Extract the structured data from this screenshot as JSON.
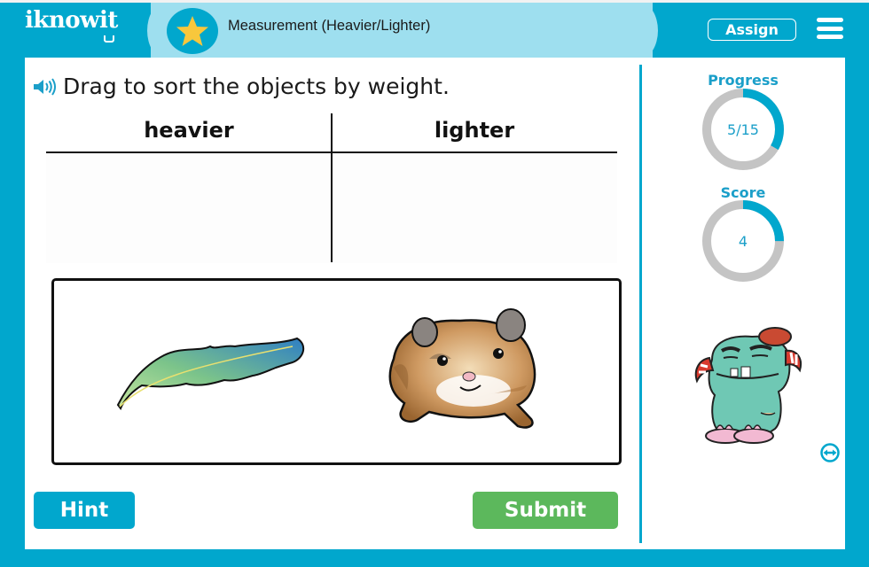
{
  "header": {
    "logo_text": "iknowit",
    "lesson_title": "Measurement (Heavier/Lighter)",
    "lesson_icon": "star-icon",
    "assign_label": "Assign",
    "menu_icon": "hamburger-menu-icon"
  },
  "question": {
    "audio_icon": "speaker-icon",
    "prompt": "Drag to sort the objects by weight."
  },
  "sort_table": {
    "columns": [
      {
        "label": "heavier",
        "items": []
      },
      {
        "label": "lighter",
        "items": []
      }
    ]
  },
  "tray": {
    "items": [
      {
        "name": "feather",
        "label": "feather"
      },
      {
        "name": "hamster",
        "label": "hamster"
      }
    ]
  },
  "buttons": {
    "hint": "Hint",
    "submit": "Submit"
  },
  "sidebar": {
    "progress": {
      "label": "Progress",
      "text": "5/15",
      "current": 5,
      "total": 15
    },
    "score": {
      "label": "Score",
      "text": "4",
      "fraction": 0.25
    },
    "mascot": "monster-mascot",
    "expand_icon": "expand-arrows-icon"
  },
  "colors": {
    "brand_blue": "#01a7cd",
    "title_bar": "#9edfef",
    "star": "#f8c73c",
    "submit_green": "#5cb85c",
    "ring_track": "#c4c4c4",
    "ring_fill": "#01a7cd",
    "label_blue": "#1b9fc9"
  }
}
